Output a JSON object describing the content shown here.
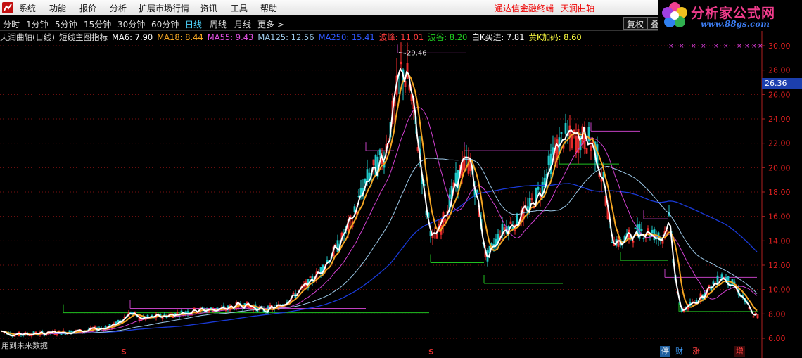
{
  "menubar": {
    "items": [
      "系统",
      "功能",
      "报价",
      "分析",
      "扩展市场行情",
      "资讯",
      "工具",
      "帮助"
    ],
    "right_text_1": "通达信金融终端",
    "right_text_2": "天润曲轴"
  },
  "watermark": {
    "title": "分析家公式网",
    "url": "www.88gs.com"
  },
  "periods": {
    "items": [
      "分时",
      "1分钟",
      "5分钟",
      "15分钟",
      "30分钟",
      "60分钟",
      "日线",
      "周线",
      "月线",
      "更多 >"
    ],
    "active": "日线",
    "fuquan": "复权",
    "die": "叠"
  },
  "indicator": {
    "name": "天润曲轴(日线)",
    "formula": "短线主图指标",
    "ma6": "MA6: 7.90",
    "ma18": "MA18: 8.44",
    "ma55": "MA55: 9.43",
    "ma125": "MA125: 12.56",
    "ma250": "MA250: 15.41",
    "wave_peak": "波峰: 11.01",
    "wave_trough": "波谷: 8.20",
    "white_k": "白K买进: 7.81",
    "yellow_k": "黄K加码: 8.60"
  },
  "colors": {
    "ma6": "#ffffff",
    "ma18": "#f5a623",
    "ma55": "#d040d0",
    "ma125": "#9cc8e8",
    "ma250": "#1a3ad8",
    "peak": "#ff3c3c",
    "trough": "#20d020",
    "white_k": "#ffffff",
    "yellow_k": "#ffff40"
  },
  "price_axis": {
    "ticks": [
      "30.00",
      "28.00",
      "26.00",
      "24.00",
      "22.00",
      "20.00",
      "18.00",
      "16.00",
      "14.00",
      "12.00",
      "10.00",
      "8.00",
      "6.00"
    ],
    "current": "26.36"
  },
  "annotations": {
    "high_label": "29.46"
  },
  "bottom": {
    "left_text": "用到未来数据",
    "s_mark": "S",
    "signals": [
      "停",
      "财",
      "涨",
      "增"
    ]
  }
}
